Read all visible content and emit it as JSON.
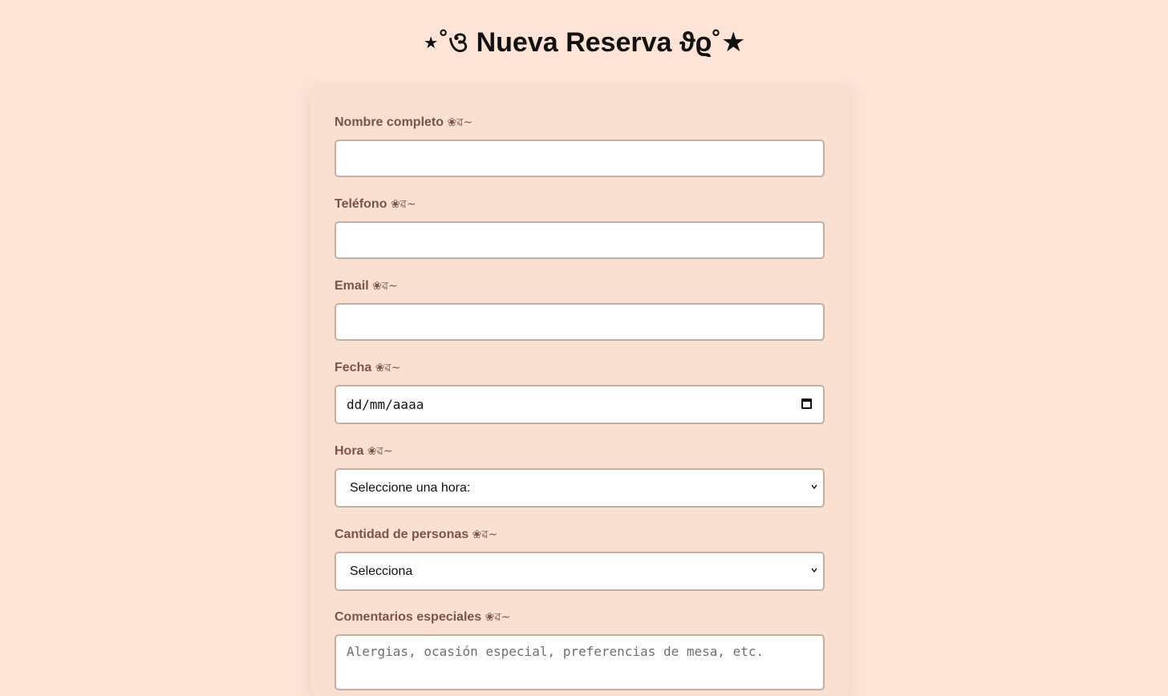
{
  "page": {
    "title": "⋆˚ও Nueva Reserva ϑϱ˚★"
  },
  "form": {
    "decoration": "❀ৱ~",
    "fields": [
      {
        "label": "Nombre completo",
        "value": "",
        "placeholder": ""
      },
      {
        "label": "Teléfono",
        "value": "",
        "placeholder": ""
      },
      {
        "label": "Email",
        "value": "",
        "placeholder": ""
      },
      {
        "label": "Fecha",
        "value": "",
        "placeholder": "dd/mm/aaaa",
        "icon": "calendar-icon"
      },
      {
        "label": "Hora",
        "selected": "Seleccione una hora:",
        "icon": "chevron-down-icon"
      },
      {
        "label": "Cantidad de personas",
        "selected": "Selecciona",
        "icon": "chevron-down-icon"
      },
      {
        "label": "Comentarios especiales",
        "value": "",
        "placeholder": "Alergias, ocasión especial, preferencias de mesa, etc."
      }
    ]
  },
  "colors": {
    "background": "#fde4d7",
    "card": "#f9e0d1",
    "label": "#7a5547",
    "input_border": "#c7aea3"
  }
}
